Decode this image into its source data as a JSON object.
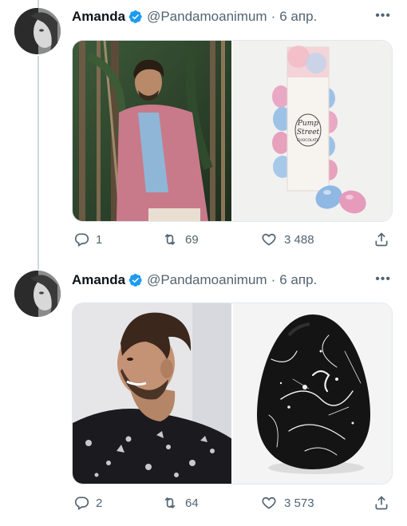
{
  "colors": {
    "text": "#0f1419",
    "secondary": "#536471",
    "verified": "#1d9bf0",
    "thread_line": "#cfd9de"
  },
  "tweets": [
    {
      "author": {
        "name": "Amanda",
        "handle": "@Pandamoanimum",
        "date": "6 апр.",
        "verified_icon": "verified-badge-icon"
      },
      "media": [
        {
          "description": "man-pink-jacket-photo"
        },
        {
          "description": "pump-street-chocolate-eggs-photo",
          "box_text_1": "Pump",
          "box_text_2": "Street",
          "box_text_3": "CHOCOLATE"
        }
      ],
      "actions": {
        "replies": "1",
        "retweets": "69",
        "likes": "3 488"
      }
    },
    {
      "author": {
        "name": "Amanda",
        "handle": "@Pandamoanimum",
        "date": "6 апр.",
        "verified_icon": "verified-badge-icon"
      },
      "media": [
        {
          "description": "man-smiling-printed-shirt-photo"
        },
        {
          "description": "black-splatter-chocolate-egg-photo"
        }
      ],
      "actions": {
        "replies": "2",
        "retweets": "64",
        "likes": "3 573"
      }
    }
  ]
}
